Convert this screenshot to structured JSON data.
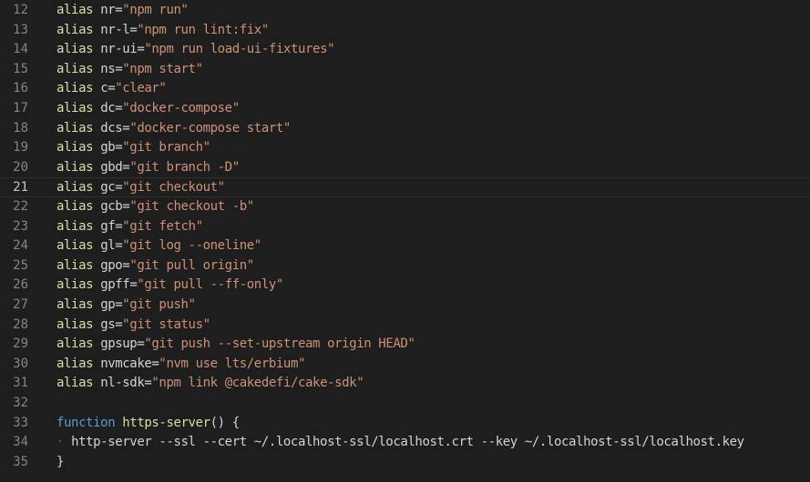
{
  "editor": {
    "lines": [
      {
        "n": "12",
        "kind": "alias",
        "kw": "alias",
        "name": "nr",
        "value": "\"npm run\""
      },
      {
        "n": "13",
        "kind": "alias",
        "kw": "alias",
        "name": "nr-l",
        "value": "\"npm run lint:fix\""
      },
      {
        "n": "14",
        "kind": "alias",
        "kw": "alias",
        "name": "nr-ui",
        "value": "\"npm run load-ui-fixtures\""
      },
      {
        "n": "15",
        "kind": "alias",
        "kw": "alias",
        "name": "ns",
        "value": "\"npm start\""
      },
      {
        "n": "16",
        "kind": "alias",
        "kw": "alias",
        "name": "c",
        "value": "\"clear\""
      },
      {
        "n": "17",
        "kind": "alias",
        "kw": "alias",
        "name": "dc",
        "value": "\"docker-compose\""
      },
      {
        "n": "18",
        "kind": "alias",
        "kw": "alias",
        "name": "dcs",
        "value": "\"docker-compose start\""
      },
      {
        "n": "19",
        "kind": "alias",
        "kw": "alias",
        "name": "gb",
        "value": "\"git branch\""
      },
      {
        "n": "20",
        "kind": "alias",
        "kw": "alias",
        "name": "gbd",
        "value": "\"git branch -D\""
      },
      {
        "n": "21",
        "kind": "alias",
        "kw": "alias",
        "name": "gc",
        "value": "\"git checkout\"",
        "current": true
      },
      {
        "n": "22",
        "kind": "alias",
        "kw": "alias",
        "name": "gcb",
        "value": "\"git checkout -b\""
      },
      {
        "n": "23",
        "kind": "alias",
        "kw": "alias",
        "name": "gf",
        "value": "\"git fetch\""
      },
      {
        "n": "24",
        "kind": "alias",
        "kw": "alias",
        "name": "gl",
        "value": "\"git log --oneline\""
      },
      {
        "n": "25",
        "kind": "alias",
        "kw": "alias",
        "name": "gpo",
        "value": "\"git pull origin\""
      },
      {
        "n": "26",
        "kind": "alias",
        "kw": "alias",
        "name": "gpff",
        "value": "\"git pull --ff-only\""
      },
      {
        "n": "27",
        "kind": "alias",
        "kw": "alias",
        "name": "gp",
        "value": "\"git push\""
      },
      {
        "n": "28",
        "kind": "alias",
        "kw": "alias",
        "name": "gs",
        "value": "\"git status\""
      },
      {
        "n": "29",
        "kind": "alias",
        "kw": "alias",
        "name": "gpsup",
        "value": "\"git push --set-upstream origin HEAD\""
      },
      {
        "n": "30",
        "kind": "alias",
        "kw": "alias",
        "name": "nvmcake",
        "value": "\"nvm use lts/erbium\""
      },
      {
        "n": "31",
        "kind": "alias",
        "kw": "alias",
        "name": "nl-sdk",
        "value": "\"npm link @cakedefi/cake-sdk\""
      },
      {
        "n": "32",
        "kind": "blank"
      },
      {
        "n": "33",
        "kind": "function",
        "kw": "function",
        "name": "https-server",
        "rest": "() {"
      },
      {
        "n": "34",
        "kind": "body",
        "text": "http-server --ssl --cert ~/.localhost-ssl/localhost.crt --key ~/.localhost-ssl/localhost.key"
      },
      {
        "n": "35",
        "kind": "close",
        "text": "}"
      }
    ]
  },
  "colors": {
    "background": "#1e1e1e",
    "keyword_alias": "#dcdcaa",
    "keyword_function": "#569cd6",
    "string": "#ce9178",
    "text": "#d4d4d4",
    "line_number": "#858585"
  }
}
